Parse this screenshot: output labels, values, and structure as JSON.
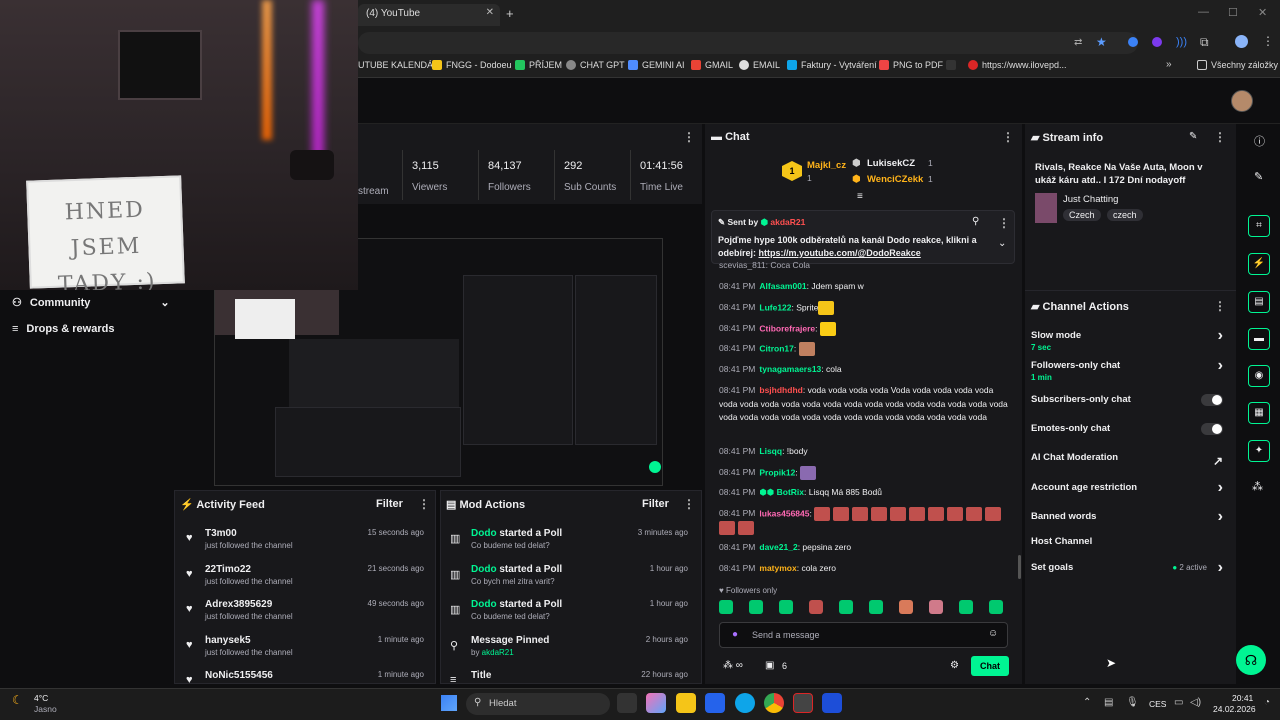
{
  "browser": {
    "tab_title": "(4) YouTube",
    "bookmarks": [
      "UTUBE KALENDÁŘ",
      "FNGG - Dodoeu",
      "PŘÍJEM",
      "CHAT GPT",
      "GEMINI AI",
      "GMAIL",
      "EMAIL",
      "Faktury - Vytváření",
      "PNG to PDF",
      "https://www.ilovepd...",
      "Všechny záložky"
    ]
  },
  "webcam": {
    "sign_text": "HNED JSEM TADY :)"
  },
  "stats": {
    "items": [
      {
        "value": "3,115",
        "label": "Viewers"
      },
      {
        "value": "84,137",
        "label": "Followers"
      },
      {
        "value": "292",
        "label": "Sub Counts"
      },
      {
        "value": "01:41:56",
        "label": "Time Live"
      }
    ],
    "partial_label": "stream"
  },
  "nav": {
    "community": "Community",
    "drops": "Drops & rewards"
  },
  "activity": {
    "title": "Activity Feed",
    "filter": "Filter",
    "items": [
      {
        "name": "T3m00",
        "sub": "just followed the channel",
        "time": "15 seconds ago"
      },
      {
        "name": "22Timo22",
        "sub": "just followed the channel",
        "time": "21 seconds ago"
      },
      {
        "name": "Adrex3895629",
        "sub": "just followed the channel",
        "time": "49 seconds ago"
      },
      {
        "name": "hanysek5",
        "sub": "just followed the channel",
        "time": "1 minute ago"
      },
      {
        "name": "NoNic5155456",
        "sub": "",
        "time": "1 minute ago"
      }
    ]
  },
  "mod": {
    "title": "Mod Actions",
    "filter": "Filter",
    "items": [
      {
        "who": "Dodo",
        "what": "started a Poll",
        "sub": "Co budeme ted delat?",
        "time": "3 minutes ago"
      },
      {
        "who": "Dodo",
        "what": "started a Poll",
        "sub": "Co bych mel zitra varit?",
        "time": "1 hour ago"
      },
      {
        "who": "Dodo",
        "what": "started a Poll",
        "sub": "Co budeme ted delat?",
        "time": "1 hour ago"
      },
      {
        "who": "",
        "what": "Message Pinned",
        "sub_prefix": "by ",
        "sub_user": "akdaR21",
        "time": "2 hours ago"
      },
      {
        "who": "",
        "what": "Title",
        "sub": "",
        "time": "22 hours ago"
      }
    ]
  },
  "chat": {
    "title": "Chat",
    "leaders": [
      {
        "rank": "1",
        "name": "Majkl_cz",
        "count": "1"
      },
      {
        "name": "LukisekCZ",
        "count": "1"
      },
      {
        "name": "WenciCZekk",
        "count": "1"
      }
    ],
    "pinned": {
      "sent_by": "Sent by",
      "user": "akdaR21",
      "text": "Pojďme hype 100k odběratelů na kanál Dodo reakce, klikni a odebírej: ",
      "link": "https://m.youtube.com/@DodoReakce"
    },
    "messages": [
      {
        "ts": "08:41 PM",
        "user": "Alfasam001",
        "color": "#00f593",
        "text": "Jdem spam w"
      },
      {
        "ts": "08:41 PM",
        "user": "Lufe122",
        "color": "#00f593",
        "text": "Sprite"
      },
      {
        "ts": "08:41 PM",
        "user": "Ctiborefrajere",
        "color": "#ff69b4",
        "text": ""
      },
      {
        "ts": "08:41 PM",
        "user": "Citron17",
        "color": "#00f593",
        "text": ""
      },
      {
        "ts": "08:41 PM",
        "user": "tynagamaers13",
        "color": "#00f593",
        "text": "cola"
      },
      {
        "ts": "08:41 PM",
        "user": "bsjhdhdhd",
        "color": "#ff5050",
        "text": "voda voda voda voda Voda voda voda voda voda voda voda voda voda voda voda voda voda voda voda voda voda voda voda voda voda voda voda voda voda voda voda voda voda voda voda voda"
      },
      {
        "ts": "08:41 PM",
        "user": "Lisqq",
        "color": "#00f593",
        "text": "!body"
      },
      {
        "ts": "08:41 PM",
        "user": "Propik12",
        "color": "#00f593",
        "text": ""
      },
      {
        "ts": "08:41 PM",
        "user": "BotRix",
        "color": "#00f593",
        "text": "Lisqq Má 885 Bodů"
      },
      {
        "ts": "08:41 PM",
        "user": "lukas456845",
        "color": "#ff69b4",
        "text": ""
      },
      {
        "ts": "08:41 PM",
        "user": "dave21_2",
        "color": "#00f593",
        "text": "pepsina zero"
      },
      {
        "ts": "08:41 PM",
        "user": "matymox",
        "color": "#ffb31a",
        "text": "cola zero"
      }
    ],
    "followers_only": "Followers only",
    "placeholder": "Send a message",
    "points": "6",
    "send": "Chat",
    "partial_top": "scevias_811: Coca Cola"
  },
  "info": {
    "title": "Stream info",
    "stream_title": "Rivals, Reakce Na Vaše Auta, Moon v ukáž káru atd.. I 172 Dní nodayoff",
    "category": "Just Chatting",
    "tags": [
      "Czech",
      "czech"
    ]
  },
  "actions": {
    "title": "Channel Actions",
    "items": [
      {
        "label": "Slow mode",
        "sub": "7 sec",
        "kind": "chev"
      },
      {
        "label": "Followers-only chat",
        "sub": "1 min",
        "kind": "chev"
      },
      {
        "label": "Subscribers-only chat",
        "kind": "toggle"
      },
      {
        "label": "Emotes-only chat",
        "kind": "toggle"
      },
      {
        "label": "AI Chat Moderation",
        "kind": "ext"
      },
      {
        "label": "Account age restriction",
        "kind": "chev"
      },
      {
        "label": "Banned words",
        "kind": "chev"
      },
      {
        "label": "Host Channel",
        "kind": "none"
      },
      {
        "label": "Set goals",
        "kind": "chev",
        "extra": "2 active"
      }
    ]
  },
  "taskbar": {
    "weather_temp": "4°C",
    "weather_desc": "Jasno",
    "search": "Hledat",
    "lang": "CES",
    "time": "20:41",
    "date": "24.02.2026"
  },
  "colors": {
    "accent": "#00f593",
    "bg": "#0e0e10",
    "panel": "#18181b"
  }
}
